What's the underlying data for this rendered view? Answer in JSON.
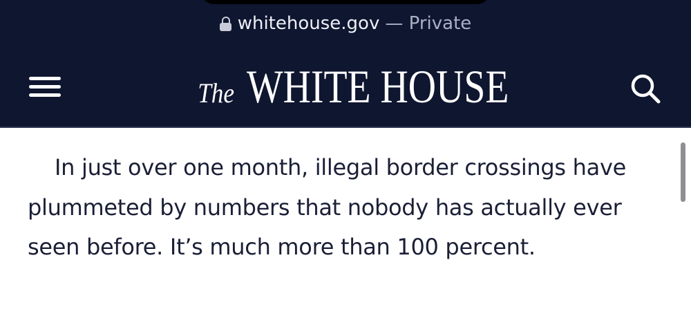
{
  "browser": {
    "domain": "whitehouse.gov",
    "mode_label": "— Private",
    "lock_icon": "lock-icon"
  },
  "header": {
    "logo_the": "The",
    "logo_main": "WHITE HOUSE",
    "menu_icon": "hamburger-menu-icon",
    "search_icon": "search-icon",
    "background_color": "#0f1630"
  },
  "article": {
    "paragraph": "In just over one month, illegal border crossings have plummeted by numbers that nobody has actually ever seen before.  It’s much more than 100 percent."
  }
}
